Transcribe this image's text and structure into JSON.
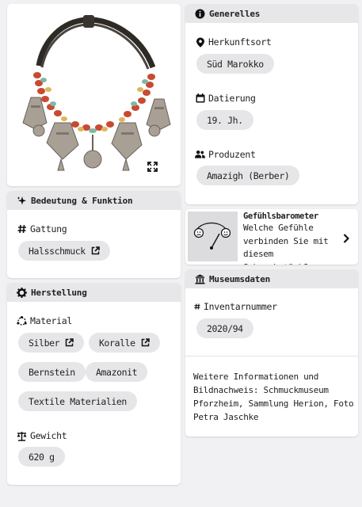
{
  "image": {
    "expand_icon": "expand-icon",
    "alt": ""
  },
  "meaning": {
    "title": "Bedeutung & Funktion",
    "gattung_label": "Gattung",
    "gattung_value": "Halsschmuck"
  },
  "production": {
    "title": "Herstellung",
    "material_label": "Material",
    "materials": [
      "Silber",
      "Koralle",
      "Bernstein",
      "Amazonit",
      "Textile Materialien"
    ],
    "weight_label": "Gewicht",
    "weight_value": "620 g"
  },
  "general": {
    "title": "Generelles",
    "origin_label": "Herkunftsort",
    "origin_value": "Süd Marokko",
    "date_label": "Datierung",
    "date_value": "19. Jh.",
    "producer_label": "Produzent",
    "producer_value": "Amazigh (Berber)"
  },
  "barometer": {
    "title": "Gefühlsbarometer",
    "text": "Welche Gefühle verbinden Sie mit diesem Schmuckstück?"
  },
  "museum": {
    "title": "Museumsdaten",
    "inventory_label": "Inventarnummer",
    "inventory_value": "2020/94",
    "more_info": "Weitere Informationen und Bildnachweis: Schmuckmuseum Pforzheim, Sammlung Herion, Foto Petra Jaschke"
  },
  "colors": {
    "chip": "#e6e6e8",
    "header": "#e7e7e9",
    "background": "#f1f1f3"
  }
}
